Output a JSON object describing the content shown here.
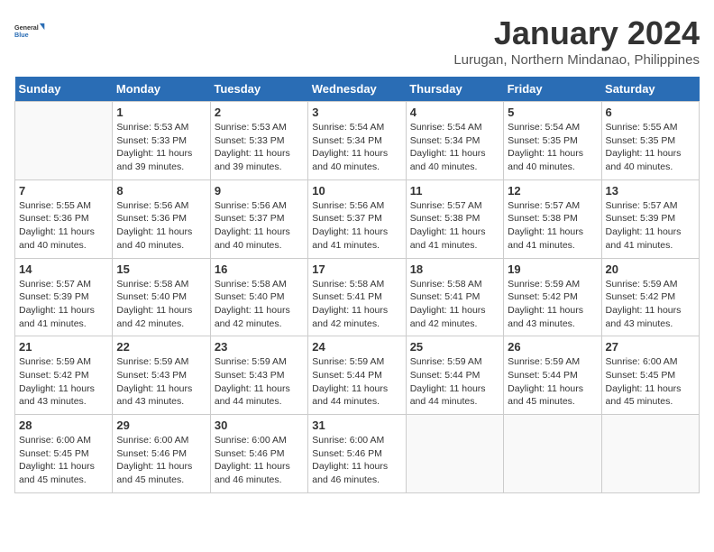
{
  "logo": {
    "line1": "General",
    "line2": "Blue"
  },
  "title": "January 2024",
  "subtitle": "Lurugan, Northern Mindanao, Philippines",
  "days_of_week": [
    "Sunday",
    "Monday",
    "Tuesday",
    "Wednesday",
    "Thursday",
    "Friday",
    "Saturday"
  ],
  "weeks": [
    [
      {
        "day": "",
        "info": ""
      },
      {
        "day": "1",
        "info": "Sunrise: 5:53 AM\nSunset: 5:33 PM\nDaylight: 11 hours\nand 39 minutes."
      },
      {
        "day": "2",
        "info": "Sunrise: 5:53 AM\nSunset: 5:33 PM\nDaylight: 11 hours\nand 39 minutes."
      },
      {
        "day": "3",
        "info": "Sunrise: 5:54 AM\nSunset: 5:34 PM\nDaylight: 11 hours\nand 40 minutes."
      },
      {
        "day": "4",
        "info": "Sunrise: 5:54 AM\nSunset: 5:34 PM\nDaylight: 11 hours\nand 40 minutes."
      },
      {
        "day": "5",
        "info": "Sunrise: 5:54 AM\nSunset: 5:35 PM\nDaylight: 11 hours\nand 40 minutes."
      },
      {
        "day": "6",
        "info": "Sunrise: 5:55 AM\nSunset: 5:35 PM\nDaylight: 11 hours\nand 40 minutes."
      }
    ],
    [
      {
        "day": "7",
        "info": "Sunrise: 5:55 AM\nSunset: 5:36 PM\nDaylight: 11 hours\nand 40 minutes."
      },
      {
        "day": "8",
        "info": "Sunrise: 5:56 AM\nSunset: 5:36 PM\nDaylight: 11 hours\nand 40 minutes."
      },
      {
        "day": "9",
        "info": "Sunrise: 5:56 AM\nSunset: 5:37 PM\nDaylight: 11 hours\nand 40 minutes."
      },
      {
        "day": "10",
        "info": "Sunrise: 5:56 AM\nSunset: 5:37 PM\nDaylight: 11 hours\nand 41 minutes."
      },
      {
        "day": "11",
        "info": "Sunrise: 5:57 AM\nSunset: 5:38 PM\nDaylight: 11 hours\nand 41 minutes."
      },
      {
        "day": "12",
        "info": "Sunrise: 5:57 AM\nSunset: 5:38 PM\nDaylight: 11 hours\nand 41 minutes."
      },
      {
        "day": "13",
        "info": "Sunrise: 5:57 AM\nSunset: 5:39 PM\nDaylight: 11 hours\nand 41 minutes."
      }
    ],
    [
      {
        "day": "14",
        "info": "Sunrise: 5:57 AM\nSunset: 5:39 PM\nDaylight: 11 hours\nand 41 minutes."
      },
      {
        "day": "15",
        "info": "Sunrise: 5:58 AM\nSunset: 5:40 PM\nDaylight: 11 hours\nand 42 minutes."
      },
      {
        "day": "16",
        "info": "Sunrise: 5:58 AM\nSunset: 5:40 PM\nDaylight: 11 hours\nand 42 minutes."
      },
      {
        "day": "17",
        "info": "Sunrise: 5:58 AM\nSunset: 5:41 PM\nDaylight: 11 hours\nand 42 minutes."
      },
      {
        "day": "18",
        "info": "Sunrise: 5:58 AM\nSunset: 5:41 PM\nDaylight: 11 hours\nand 42 minutes."
      },
      {
        "day": "19",
        "info": "Sunrise: 5:59 AM\nSunset: 5:42 PM\nDaylight: 11 hours\nand 43 minutes."
      },
      {
        "day": "20",
        "info": "Sunrise: 5:59 AM\nSunset: 5:42 PM\nDaylight: 11 hours\nand 43 minutes."
      }
    ],
    [
      {
        "day": "21",
        "info": "Sunrise: 5:59 AM\nSunset: 5:42 PM\nDaylight: 11 hours\nand 43 minutes."
      },
      {
        "day": "22",
        "info": "Sunrise: 5:59 AM\nSunset: 5:43 PM\nDaylight: 11 hours\nand 43 minutes."
      },
      {
        "day": "23",
        "info": "Sunrise: 5:59 AM\nSunset: 5:43 PM\nDaylight: 11 hours\nand 44 minutes."
      },
      {
        "day": "24",
        "info": "Sunrise: 5:59 AM\nSunset: 5:44 PM\nDaylight: 11 hours\nand 44 minutes."
      },
      {
        "day": "25",
        "info": "Sunrise: 5:59 AM\nSunset: 5:44 PM\nDaylight: 11 hours\nand 44 minutes."
      },
      {
        "day": "26",
        "info": "Sunrise: 5:59 AM\nSunset: 5:44 PM\nDaylight: 11 hours\nand 45 minutes."
      },
      {
        "day": "27",
        "info": "Sunrise: 6:00 AM\nSunset: 5:45 PM\nDaylight: 11 hours\nand 45 minutes."
      }
    ],
    [
      {
        "day": "28",
        "info": "Sunrise: 6:00 AM\nSunset: 5:45 PM\nDaylight: 11 hours\nand 45 minutes."
      },
      {
        "day": "29",
        "info": "Sunrise: 6:00 AM\nSunset: 5:46 PM\nDaylight: 11 hours\nand 45 minutes."
      },
      {
        "day": "30",
        "info": "Sunrise: 6:00 AM\nSunset: 5:46 PM\nDaylight: 11 hours\nand 46 minutes."
      },
      {
        "day": "31",
        "info": "Sunrise: 6:00 AM\nSunset: 5:46 PM\nDaylight: 11 hours\nand 46 minutes."
      },
      {
        "day": "",
        "info": ""
      },
      {
        "day": "",
        "info": ""
      },
      {
        "day": "",
        "info": ""
      }
    ]
  ]
}
